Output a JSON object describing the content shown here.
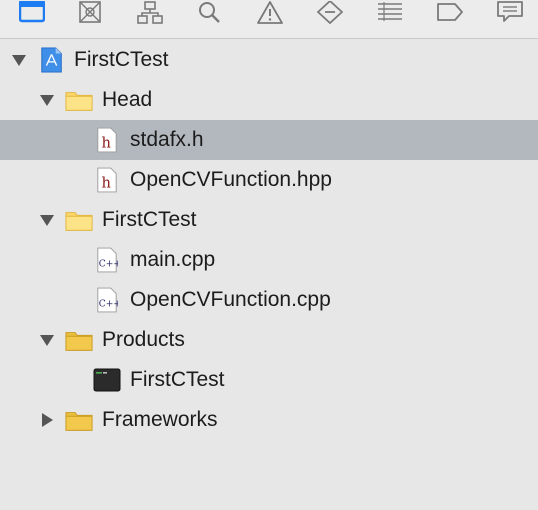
{
  "toolbar": {
    "icons": [
      "project-navigator-icon",
      "source-control-icon",
      "symbol-hierarchy-icon",
      "search-icon",
      "warning-icon",
      "breakpoint-icon",
      "list-icon",
      "tag-icon",
      "comment-icon"
    ]
  },
  "tree": [
    {
      "label": "FirstCTest",
      "type": "project",
      "depth": 0,
      "expanded": true
    },
    {
      "label": "Head",
      "type": "folder",
      "depth": 1,
      "expanded": true
    },
    {
      "label": "stdafx.h",
      "type": "header",
      "depth": 2,
      "selected": true
    },
    {
      "label": "OpenCVFunction.hpp",
      "type": "header",
      "depth": 2
    },
    {
      "label": "FirstCTest",
      "type": "folder",
      "depth": 1,
      "expanded": true
    },
    {
      "label": "main.cpp",
      "type": "cpp",
      "depth": 2
    },
    {
      "label": "OpenCVFunction.cpp",
      "type": "cpp",
      "depth": 2
    },
    {
      "label": "Products",
      "type": "folder-yellow",
      "depth": 1,
      "expanded": true
    },
    {
      "label": "FirstCTest",
      "type": "executable",
      "depth": 2
    },
    {
      "label": "Frameworks",
      "type": "folder-yellow",
      "depth": 1,
      "expanded": false
    }
  ],
  "colors": {
    "selection": "#b3b8bf",
    "accent": "#1d7cf2",
    "folder": "#f9d56a"
  }
}
